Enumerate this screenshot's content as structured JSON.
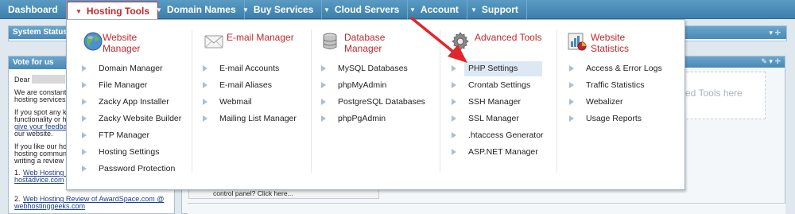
{
  "nav": {
    "items": [
      {
        "label": "Dashboard",
        "has_tri": false
      },
      {
        "label": "Hosting Tools",
        "has_tri": true,
        "active": true
      },
      {
        "label": "Domain Names",
        "has_tri": true
      },
      {
        "label": "Buy Services",
        "has_tri": true
      },
      {
        "label": "Cloud Servers",
        "has_tri": true
      },
      {
        "label": "Account",
        "has_tri": true
      },
      {
        "label": "Support",
        "has_tri": true
      }
    ]
  },
  "background": {
    "system_status": "System Status",
    "vote_title": "Vote for us",
    "dear": "Dear",
    "para1": [
      "We are constant",
      "hosting services"
    ],
    "para2": [
      "If you spot any ki",
      "functionality or hi",
      "give your feedba",
      "our website."
    ],
    "para3": [
      "If you like our hos",
      "hosting communit",
      "writing a review"
    ],
    "link1a": "Web Hosting R",
    "link1b": "hostadvice.com",
    "link2a": "Web Hosting Review of AwardSpace.com @",
    "link2b": "webhostinggeeks.com",
    "num1": "1.",
    "num2": "2.",
    "tools_hint": "ed Tools here",
    "control_panel_hint": "control panel? Click here..."
  },
  "menu": {
    "columns": [
      {
        "title": "Website Manager",
        "icon": "globe-icon",
        "items": [
          "Domain Manager",
          "File Manager",
          "Zacky App Installer",
          "Zacky Website Builder",
          "FTP Manager",
          "Hosting Settings",
          "Password Protection"
        ]
      },
      {
        "title": "E-mail Manager",
        "icon": "envelope-icon",
        "items": [
          "E-mail Accounts",
          "E-mail Aliases",
          "Webmail",
          "Mailing List Manager"
        ]
      },
      {
        "title": "Database Manager",
        "icon": "database-icon",
        "items": [
          "MySQL Databases",
          "phpMyAdmin",
          "PostgreSQL Databases",
          "phpPgAdmin"
        ]
      },
      {
        "title": "Advanced Tools",
        "icon": "gear-icon",
        "items": [
          "PHP Settings",
          "Crontab Settings",
          "SSH Manager",
          "SSL Manager",
          ".htaccess Generator",
          "ASP.NET Manager"
        ]
      },
      {
        "title": "Website Statistics",
        "icon": "statistics-icon",
        "items": [
          "Access & Error Logs",
          "Traffic Statistics",
          "Webalizer",
          "Usage Reports"
        ]
      }
    ],
    "highlighted": "PHP Settings"
  },
  "colors": {
    "accent": "#c0282d",
    "nav": "#4a89b5",
    "highlight": "#dce9f5"
  }
}
